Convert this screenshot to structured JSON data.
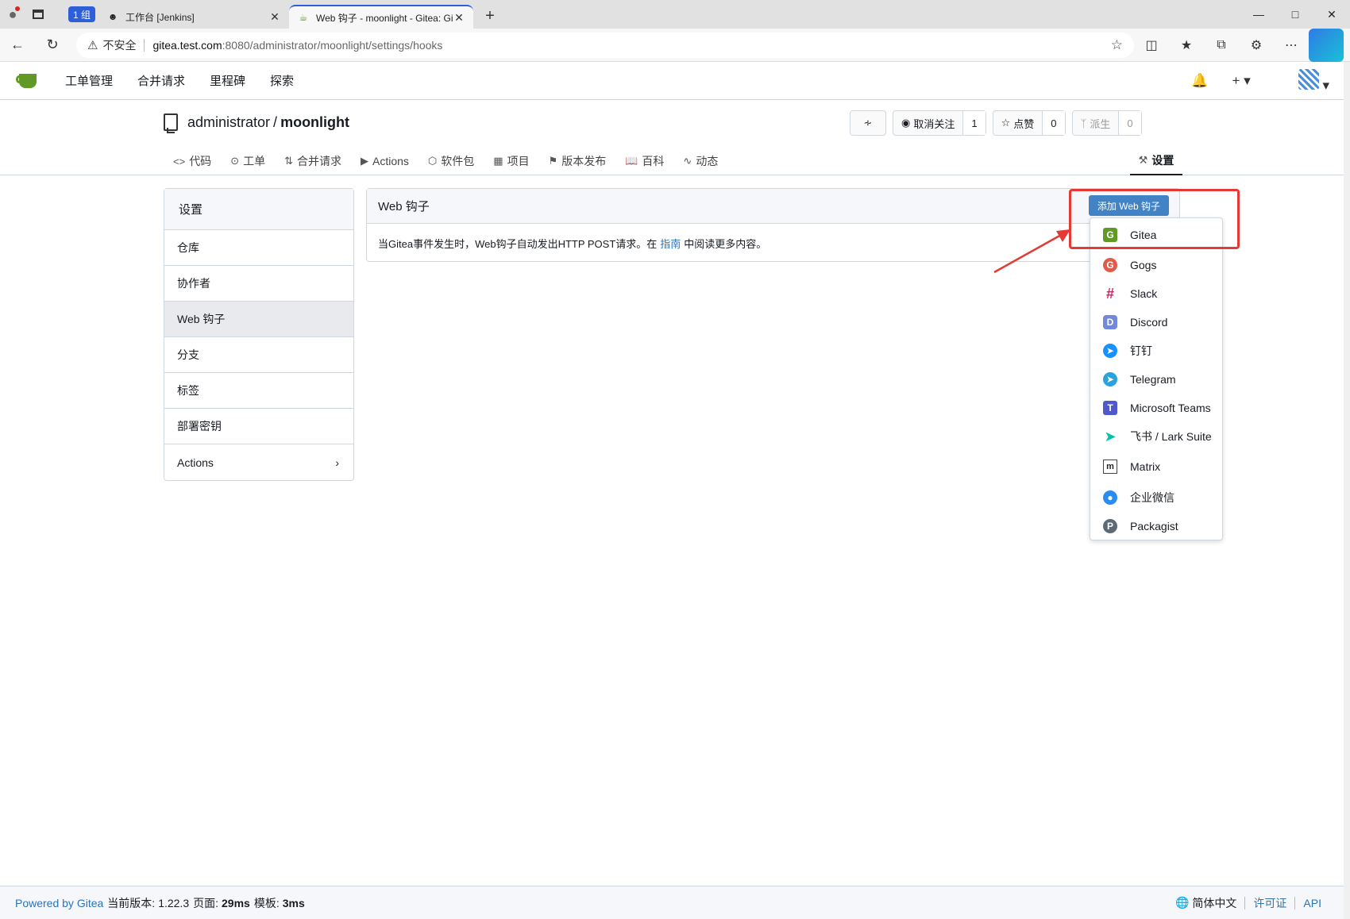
{
  "browser": {
    "tab_group": "1 组",
    "tabs": [
      {
        "title": "工作台 [Jenkins]"
      },
      {
        "title": "Web 钩子 - moonlight - Gitea: Git"
      }
    ],
    "insecure_label": "不安全",
    "url_host": "gitea.test.com",
    "url_path": ":8080/administrator/moonlight/settings/hooks"
  },
  "nav": {
    "items": [
      "工单管理",
      "合并请求",
      "里程碑",
      "探索"
    ]
  },
  "repo": {
    "owner": "administrator",
    "separator": "/",
    "name": "moonlight",
    "watch_label": "取消关注",
    "watch_count": "1",
    "star_label": "点赞",
    "star_count": "0",
    "fork_label": "派生",
    "fork_count": "0",
    "tabs": [
      "代码",
      "工单",
      "合并请求",
      "Actions",
      "软件包",
      "项目",
      "版本发布",
      "百科",
      "动态"
    ],
    "settings_tab": "设置"
  },
  "sidebar": {
    "title": "设置",
    "items": [
      "仓库",
      "协作者",
      "Web 钩子",
      "分支",
      "标签",
      "部署密钥",
      "Actions"
    ],
    "active": "Web 钩子"
  },
  "panel": {
    "title": "Web 钩子",
    "desc_before": "当Gitea事件发生时，Web钩子自动发出HTTP POST请求。在",
    "desc_link": "指南",
    "desc_after": "中阅读更多内容。",
    "add_button": "添加 Web 钩子"
  },
  "dropdown": {
    "items": [
      "Gitea",
      "Gogs",
      "Slack",
      "Discord",
      "钉钉",
      "Telegram",
      "Microsoft Teams",
      "飞书 / Lark Suite",
      "Matrix",
      "企业微信",
      "Packagist"
    ]
  },
  "footer": {
    "powered": "Powered by Gitea",
    "version_label": "当前版本:",
    "version": "1.22.3",
    "page_label": "页面:",
    "page_time": "29ms",
    "template_label": "模板:",
    "template_time": "3ms",
    "language": "简体中文",
    "license": "许可证",
    "api": "API"
  },
  "colors": {
    "gitea_green": "#609926",
    "primary_blue": "#4183c4",
    "annotation_red": "#e53935"
  }
}
